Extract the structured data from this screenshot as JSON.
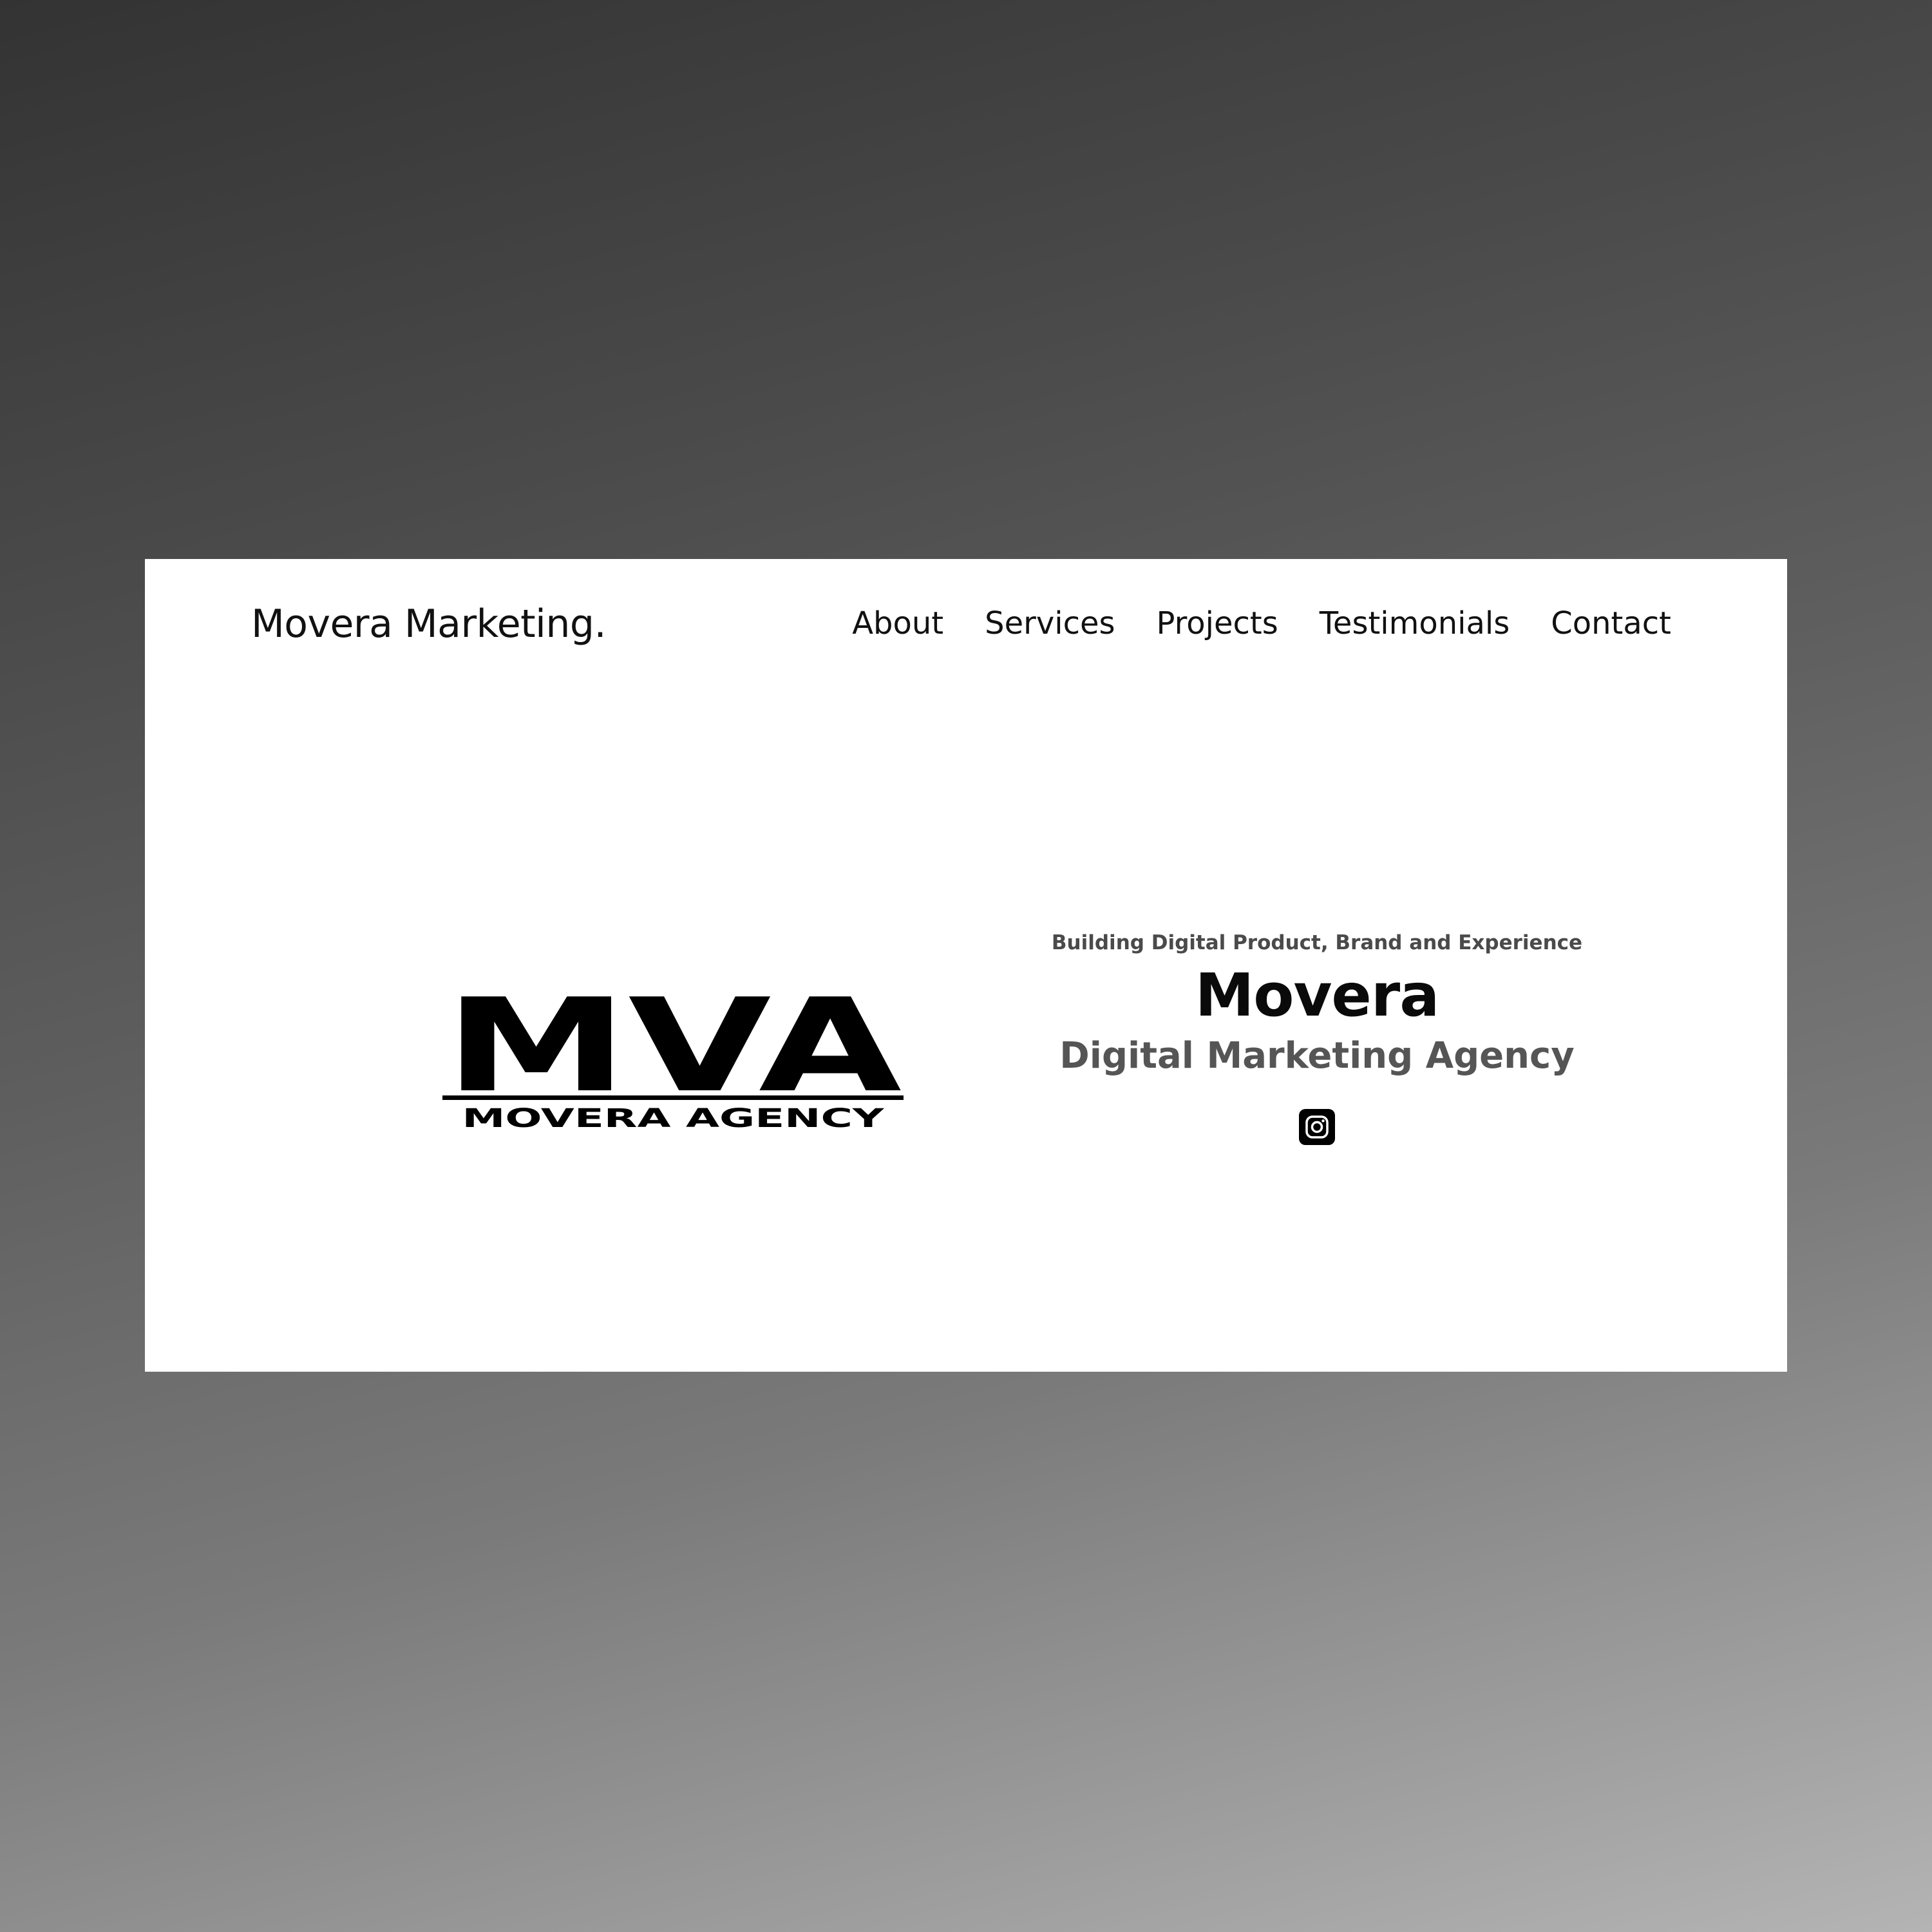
{
  "header": {
    "brand": "Movera Marketing.",
    "nav": [
      {
        "label": "About"
      },
      {
        "label": "Services"
      },
      {
        "label": "Projects"
      },
      {
        "label": "Testimonials"
      },
      {
        "label": "Contact"
      }
    ]
  },
  "logo": {
    "monogram": "MVA",
    "wordmark": "MOVERA AGENCY"
  },
  "hero": {
    "tagline": "Building Digital Product, Brand and Experience",
    "title": "Movera",
    "subtitle": "Digital Marketing Agency"
  },
  "social": {
    "icon": "instagram-icon"
  },
  "colors": {
    "page_background_top": "#333333",
    "page_background_bottom": "#b4b4b4",
    "window_background": "#ffffff",
    "text_primary": "#111111",
    "text_secondary": "#555555"
  }
}
